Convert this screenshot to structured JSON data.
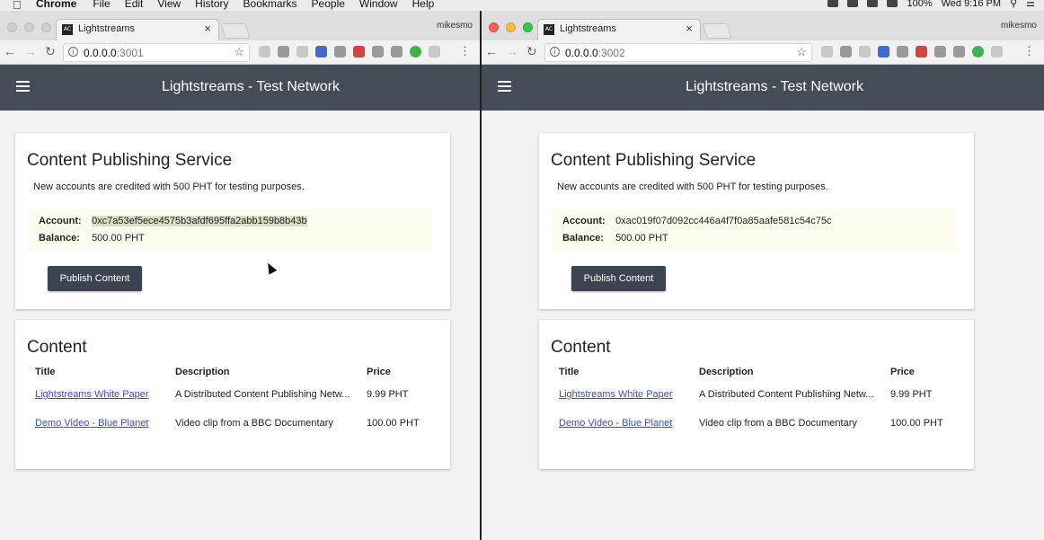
{
  "menubar": {
    "app": "Chrome",
    "items": [
      "File",
      "Edit",
      "View",
      "History",
      "Bookmarks",
      "People",
      "Window",
      "Help"
    ],
    "battery": "100%",
    "clock": "Wed 9:16 PM"
  },
  "left": {
    "tab_title": "Lightstreams",
    "profile": "mikesmo",
    "url_host": "0.0.0.0",
    "url_port": ":3001",
    "app_title": "Lightstreams - Test Network",
    "service_title": "Content Publishing Service",
    "note": "New accounts are credited with 500 PHT for testing purposes.",
    "account_label": "Account:",
    "account_value": "0xc7a53ef5ece4575b3afdf695ffa2abb159b8b43b",
    "balance_label": "Balance:",
    "balance_value": "500.00 PHT",
    "publish_label": "Publish Content",
    "content_title": "Content",
    "columns": [
      "Title",
      "Description",
      "Price"
    ],
    "rows": [
      {
        "title": "Lightstreams White Paper",
        "description": "A Distributed Content Publishing Netw...",
        "price": "9.99 PHT"
      },
      {
        "title": "Demo Video - Blue Planet",
        "description": "Video clip from a BBC Documentary",
        "price": "100.00 PHT"
      }
    ]
  },
  "right": {
    "tab_title": "Lightstreams",
    "profile": "mikesmo",
    "url_host": "0.0.0.0",
    "url_port": ":3002",
    "app_title": "Lightstreams - Test Network",
    "service_title": "Content Publishing Service",
    "note": "New accounts are credited with 500 PHT for testing purposes.",
    "account_label": "Account:",
    "account_value": "0xac019f07d092cc446a4f7f0a85aafe581c54c75c",
    "balance_label": "Balance:",
    "balance_value": "500.00 PHT",
    "publish_label": "Publish Content",
    "content_title": "Content",
    "columns": [
      "Title",
      "Description",
      "Price"
    ],
    "rows": [
      {
        "title": "Lightstreams White Paper",
        "description": "A Distributed Content Publishing Netw...",
        "price": "9.99 PHT"
      },
      {
        "title": "Demo Video - Blue Planet",
        "description": "Video clip from a BBC Documentary",
        "price": "100.00 PHT"
      }
    ]
  },
  "colors": {
    "appbar": "#444c58",
    "button": "#3c4450",
    "link": "#3b4fb8",
    "account_bg": "#fcfcee"
  },
  "icons": [
    "apple-icon",
    "info-icon",
    "star-icon",
    "hamburger-icon",
    "back-arrow-icon",
    "forward-arrow-icon",
    "reload-icon",
    "close-icon",
    "wifi-icon",
    "search-icon"
  ]
}
